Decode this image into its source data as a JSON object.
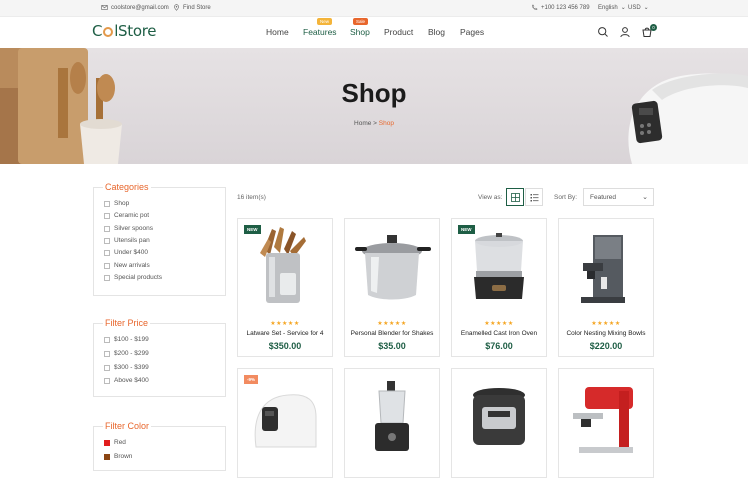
{
  "topbar": {
    "email": "coolstore@gmail.com",
    "store_link": "Find Store",
    "phone": "+100 123 456 789",
    "language": "English",
    "currency": "USD"
  },
  "header": {
    "logo": {
      "pre": "C",
      "post": "lStore"
    },
    "nav": [
      {
        "label": "Home",
        "badge": ""
      },
      {
        "label": "Features",
        "badge": "New"
      },
      {
        "label": "Shop",
        "badge": "Sale"
      },
      {
        "label": "Product",
        "badge": ""
      },
      {
        "label": "Blog",
        "badge": ""
      },
      {
        "label": "Pages",
        "badge": ""
      }
    ],
    "cart_count": "0",
    "badge_colors": {
      "New": "#f4b43a",
      "Sale": "#e8662c"
    }
  },
  "hero": {
    "title": "Shop",
    "breadcrumb_home": "Home",
    "breadcrumb_sep": ">",
    "breadcrumb_current": "Shop"
  },
  "sidebar": {
    "categories_title": "Categories",
    "categories": [
      "Shop",
      "Ceramic pot",
      "Silver spoons",
      "Utensils pan",
      "Under $400",
      "New arrivals",
      "Special products"
    ],
    "price_title": "Filter Price",
    "prices": [
      "$100 - $199",
      "$200 - $299",
      "$300 - $399",
      "Above $400"
    ],
    "color_title": "Filter Color",
    "colors": [
      {
        "name": "Red",
        "hex": "#e11d1d"
      },
      {
        "name": "Brown",
        "hex": "#8b4513"
      }
    ]
  },
  "toolbar": {
    "count": "16 item(s)",
    "view_as": "View as:",
    "sort_by": "Sort By:",
    "sort_value": "Featured"
  },
  "products": [
    {
      "name": "Latware Set - Service for 4",
      "price": "$350.00",
      "tag": "NEW",
      "tag_color": "#1e5e45",
      "stars": "★★★★★",
      "icon": "utensil-holder-image"
    },
    {
      "name": "Personal Blender for Shakes",
      "price": "$35.00",
      "tag": "",
      "tag_color": "",
      "stars": "★★★★★",
      "icon": "pressure-cooker-image"
    },
    {
      "name": "Enamelled Cast Iron Oven",
      "price": "$76.00",
      "tag": "NEW",
      "tag_color": "#1e5e45",
      "stars": "★★★★★",
      "icon": "food-steamer-image"
    },
    {
      "name": "Color Nesting Mixing Bowls",
      "price": "$220.00",
      "tag": "",
      "tag_color": "",
      "stars": "★★★★★",
      "icon": "coffee-machine-image"
    },
    {
      "name": "",
      "price": "",
      "tag": "-9%",
      "tag_color": "#f28b60",
      "stars": "",
      "icon": "bread-maker-image"
    },
    {
      "name": "",
      "price": "",
      "tag": "",
      "tag_color": "",
      "stars": "",
      "icon": "food-processor-image"
    },
    {
      "name": "",
      "price": "",
      "tag": "",
      "tag_color": "",
      "stars": "",
      "icon": "rice-cooker-image"
    },
    {
      "name": "",
      "price": "",
      "tag": "",
      "tag_color": "",
      "stars": "",
      "icon": "espresso-machine-image"
    }
  ]
}
